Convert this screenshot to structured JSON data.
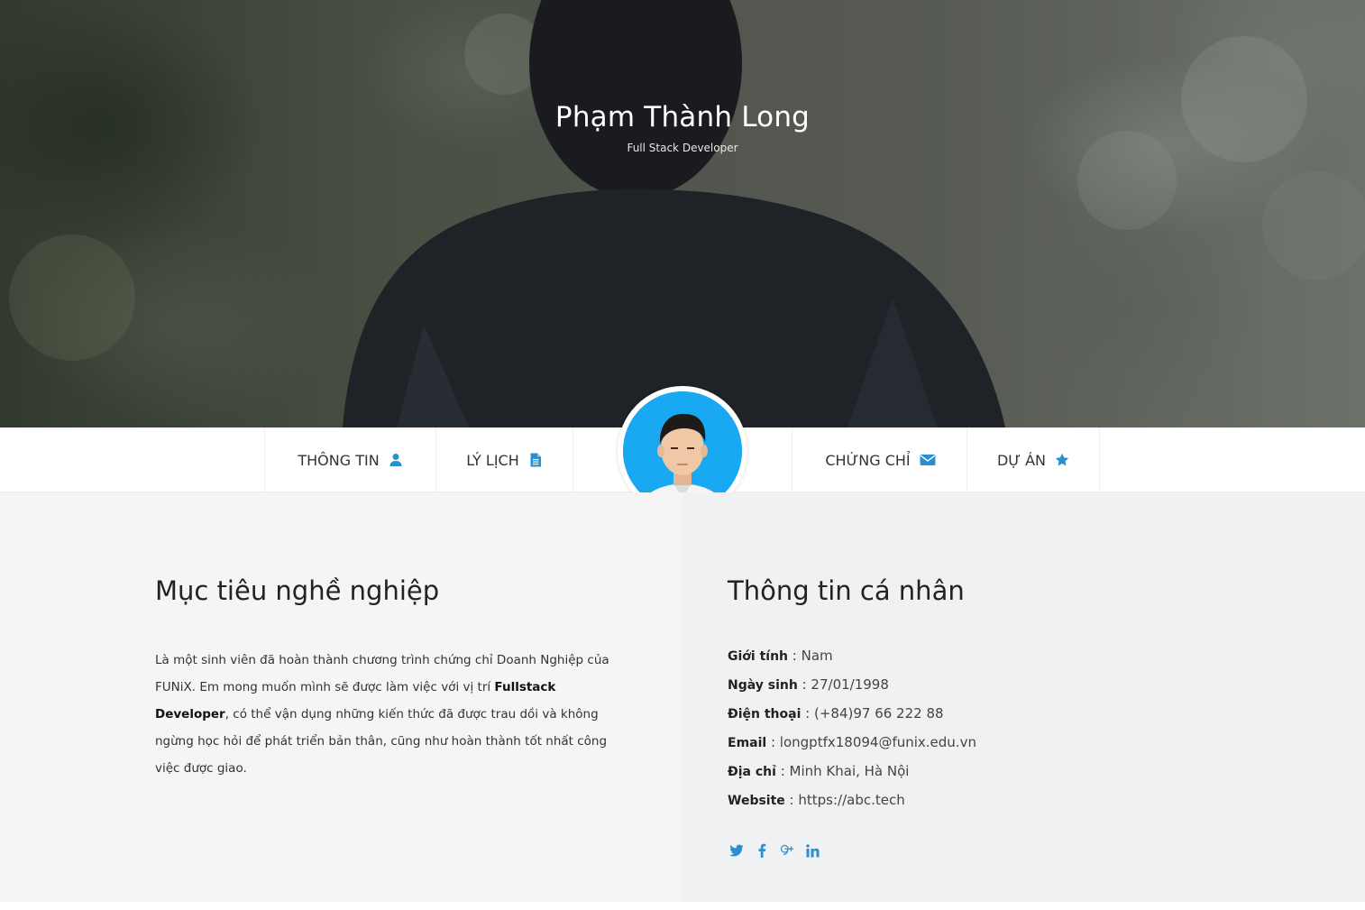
{
  "hero": {
    "name": "Phạm Thành Long",
    "role": "Full Stack Developer"
  },
  "nav": {
    "items": [
      {
        "label": "THÔNG TIN",
        "icon": "user-icon"
      },
      {
        "label": "LÝ LỊCH",
        "icon": "document-icon"
      },
      {
        "label": "CHỨNG CHỈ",
        "icon": "envelope-icon"
      },
      {
        "label": "DỰ ÁN",
        "icon": "star-icon"
      }
    ]
  },
  "objective": {
    "title": "Mục tiêu nghề nghiệp",
    "text_before": "Là một sinh viên đã hoàn thành chương trình chứng chỉ Doanh Nghiệp của FUNiX. Em mong muốn mình sẽ được làm việc với vị trí ",
    "highlight": "Fullstack Developer",
    "text_after": ", có thể vận dụng những kiến thức đã được trau dồi và không ngừng học hỏi để phát triển bản thân, cũng như hoàn thành tốt nhất công việc được giao."
  },
  "personal": {
    "title": "Thông tin cá nhân",
    "rows": [
      {
        "label": "Giới tính",
        "value": "Nam"
      },
      {
        "label": "Ngày sinh",
        "value": "27/01/1998"
      },
      {
        "label": "Điện thoại",
        "value": "(+84)97 66 222 88"
      },
      {
        "label": "Email",
        "value": "longptfx18094@funix.edu.vn"
      },
      {
        "label": "Địa chỉ",
        "value": "Minh Khai, Hà Nội"
      },
      {
        "label": "Website",
        "value": "https://abc.tech"
      }
    ],
    "separator": " : "
  },
  "social": [
    "twitter-icon",
    "facebook-icon",
    "google-plus-icon",
    "linkedin-icon"
  ],
  "colors": {
    "accent": "#2a8fd0",
    "avatar_bg": "#18a9f2"
  }
}
